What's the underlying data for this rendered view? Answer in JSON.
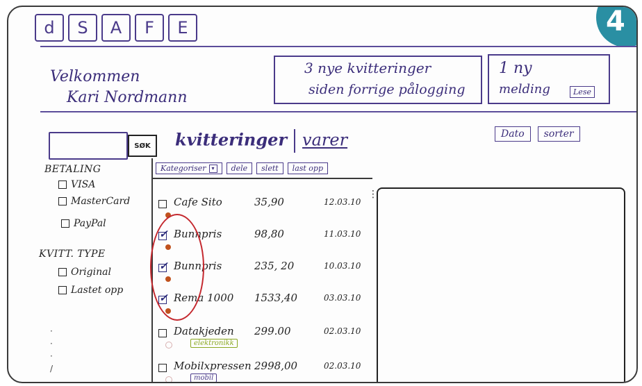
{
  "logo": {
    "letters": [
      "d",
      "S",
      "A",
      "F",
      "E"
    ]
  },
  "corner_badge": "4",
  "welcome": {
    "line1": "Velkommen",
    "line2": "Kari Nordmann"
  },
  "notification": {
    "line1": "3 nye kvitteringer",
    "line2": "siden forrige pålogging"
  },
  "message": {
    "line1": "1 ny",
    "line2": "melding",
    "read_label": "Lese"
  },
  "search": {
    "button_label": "SØK",
    "value": ""
  },
  "tabs": {
    "active": "kvitteringer",
    "other": "varer"
  },
  "sort": {
    "date_label": "Dato",
    "sort_label": "sorter"
  },
  "filters": {
    "payment_title": "BETALING",
    "payment_options": [
      {
        "label": "VISA",
        "checked": false
      },
      {
        "label": "MasterCard",
        "checked": false
      },
      {
        "label": "PayPal",
        "checked": false
      }
    ],
    "type_title": "KVITT. TYPE",
    "type_options": [
      {
        "label": "Original",
        "checked": false
      },
      {
        "label": "Lastet opp",
        "checked": false
      }
    ]
  },
  "toolbar": {
    "categorize": "Kategoriser",
    "share": "dele",
    "delete": "slett",
    "upload": "last opp"
  },
  "receipts": [
    {
      "store": "Cafe Sito",
      "amount": "35,90",
      "date": "12.03.10",
      "checked": false,
      "dot": "orange",
      "tag": ""
    },
    {
      "store": "Bunnpris",
      "amount": "98,80",
      "date": "11.03.10",
      "checked": true,
      "dot": "orange",
      "tag": ""
    },
    {
      "store": "Bunnpris",
      "amount": "235, 20",
      "date": "10.03.10",
      "checked": true,
      "dot": "orange",
      "tag": ""
    },
    {
      "store": "Rema 1000",
      "amount": "1533,40",
      "date": "03.03.10",
      "checked": true,
      "dot": "orange",
      "tag": ""
    },
    {
      "store": "Datakjeden",
      "amount": "299.00",
      "date": "02.03.10",
      "checked": false,
      "dot": "ghost",
      "tag": "elektronikk"
    },
    {
      "store": "Mobilxpressen",
      "amount": "2998,00",
      "date": "02.03.10",
      "checked": false,
      "dot": "ghost",
      "tag": "mobil"
    }
  ],
  "colors": {
    "ink": "#3b2d7a",
    "highlight_circle": "#c4282e",
    "badge": "#2a8fa3",
    "tag_green": "#8aa820"
  }
}
